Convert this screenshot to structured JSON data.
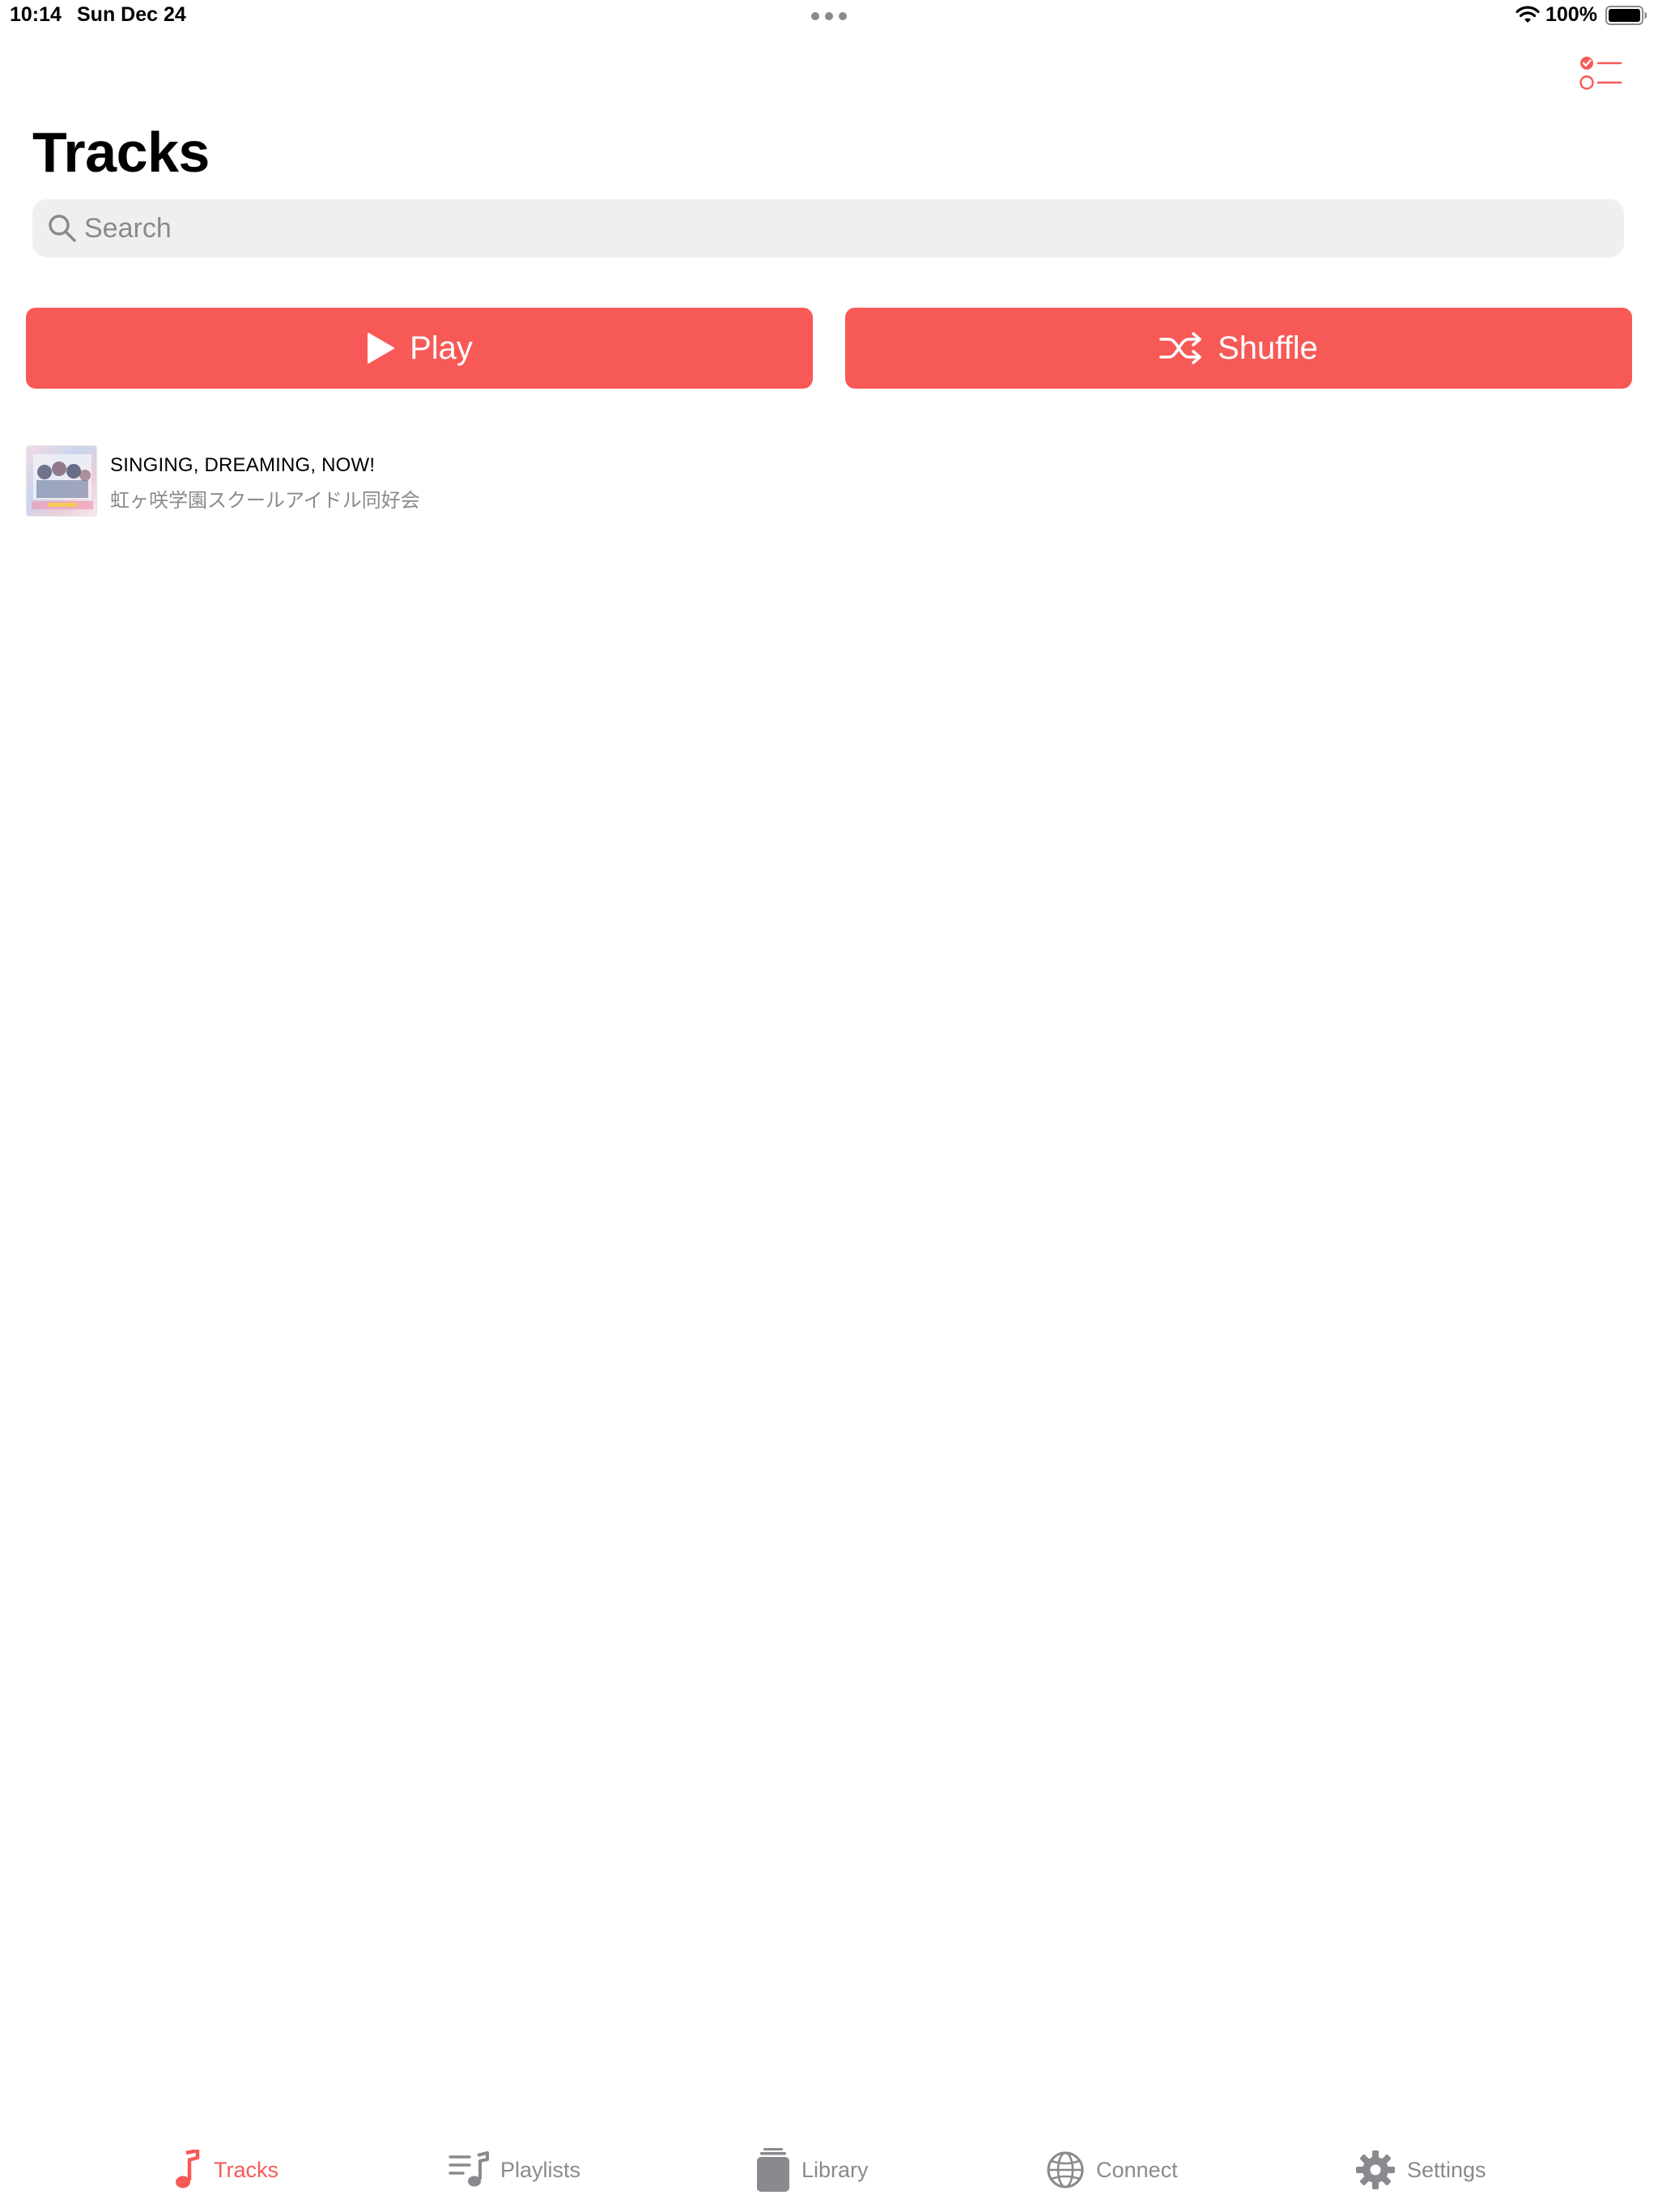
{
  "status_bar": {
    "time": "10:14",
    "date": "Sun Dec 24",
    "battery": "100%"
  },
  "header": {
    "title": "Tracks",
    "select_icon": "checklist-icon"
  },
  "search": {
    "placeholder": "Search",
    "value": ""
  },
  "actions": {
    "play_label": "Play",
    "shuffle_label": "Shuffle"
  },
  "tracks": [
    {
      "title": "SINGING, DREAMING, NOW!",
      "artist": "虹ヶ咲学園スクールアイドル同好会"
    }
  ],
  "tab_bar": {
    "items": [
      {
        "label": "Tracks",
        "icon": "music-note-icon",
        "active": true
      },
      {
        "label": "Playlists",
        "icon": "playlist-icon",
        "active": false
      },
      {
        "label": "Library",
        "icon": "library-stack-icon",
        "active": false
      },
      {
        "label": "Connect",
        "icon": "globe-icon",
        "active": false
      },
      {
        "label": "Settings",
        "icon": "gear-icon",
        "active": false
      }
    ]
  },
  "colors": {
    "accent": "#f75957",
    "secondary_text": "#8a8a8e",
    "search_bg": "#efeff0"
  }
}
